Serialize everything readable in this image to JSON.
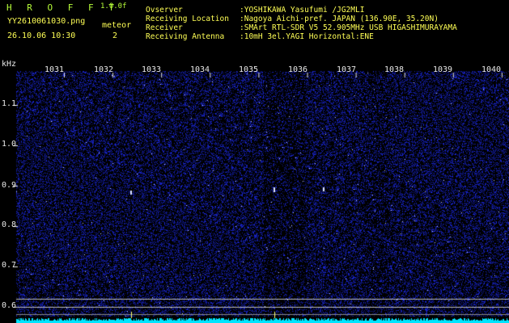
{
  "header": {
    "brand": "H R O F F T",
    "version": "1.0.0f",
    "filename": "YY2610061030.png",
    "datetime": "26.10.06 10:30",
    "meteor_label": "meteor",
    "meteor_count": "2"
  },
  "info": {
    "labels": [
      "Ovserver",
      "Receiving Location",
      "Receiver",
      "Receiving Antenna"
    ],
    "values": [
      ":YOSHIKAWA Yasufumi /JG2MLI",
      ":Nagoya Aichi-pref. JAPAN (136.90E, 35.20N)",
      ":SMArt RTL-SDR V5 52.905MHz USB HIGASHIMURAYAMA",
      ":10mH 3el.YAGI Horizontal:ENE"
    ]
  },
  "axes": {
    "y_unit": "kHz",
    "y_ticks": [
      "1.1",
      "1.0",
      "0.9",
      "0.8",
      "0.7",
      "0.6"
    ],
    "x_ticks": [
      "1031",
      "1032",
      "1033",
      "1034",
      "1035",
      "1036",
      "1037",
      "1038",
      "1039",
      "1040"
    ]
  },
  "colors": {
    "background": "#000000",
    "noise": "#1c2cb8",
    "spectrum": "#00e5ff"
  }
}
